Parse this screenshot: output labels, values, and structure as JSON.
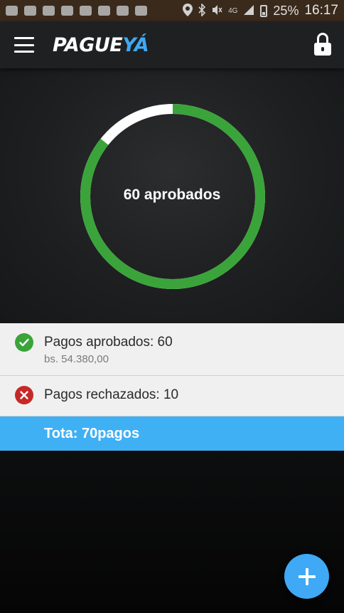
{
  "status_bar": {
    "battery_percent": "25%",
    "time": "16:17",
    "network_label": "4G",
    "icons": [
      "message-icon",
      "gmail-icon",
      "gallery-icon",
      "image-icon",
      "wifi-calling-icon",
      "video-icon",
      "twitter-icon",
      "photo-icon",
      "location-icon",
      "bluetooth-icon",
      "mute-icon",
      "signal-icon"
    ]
  },
  "app_bar": {
    "logo_part1": "PAGUE",
    "logo_part2": "YÁ",
    "menu_icon": "hamburger-menu-icon",
    "lock_icon": "lock-icon"
  },
  "summary": {
    "label": "60 aprobados",
    "approved_count": 60,
    "rejected_count": 10,
    "total_count": 70,
    "colors": {
      "approved": "#3aa43a",
      "rest": "#ffffff",
      "accent": "#40b0f5",
      "rejected": "#c62828"
    }
  },
  "list": {
    "approved": {
      "title": "Pagos aprobados: 60",
      "amount": "bs. 54.380,00",
      "icon": "check-circle-icon"
    },
    "rejected": {
      "title": "Pagos rechazados: 10",
      "icon": "x-circle-icon"
    },
    "total": "Tota: 70pagos"
  },
  "fab": {
    "icon": "plus-icon"
  }
}
